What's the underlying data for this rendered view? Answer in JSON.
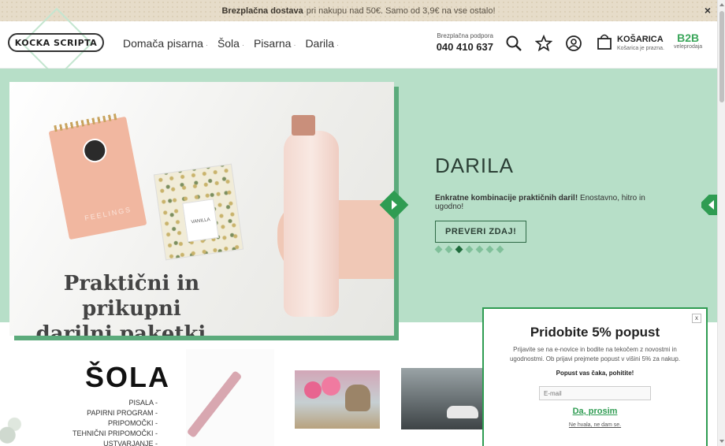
{
  "announcement": {
    "bold": "Brezplačna dostava",
    "text": "pri nakupu nad 50€. Samo od 3,9€ na vse ostalo!",
    "close": "×"
  },
  "header": {
    "logo": "KOCKA SCRIPTA",
    "nav": [
      {
        "label": "Domača pisarna"
      },
      {
        "label": "Šola"
      },
      {
        "label": "Pisarna"
      },
      {
        "label": "Darila"
      }
    ],
    "nav_arrow": "·",
    "support_label": "Brezplačna podpora",
    "support_phone": "040 410 637",
    "cart_title": "KOŠARICA",
    "cart_sub": "Košarica je prazna.",
    "b2b": "B2B",
    "b2b_sub": "veleprodaja"
  },
  "hero": {
    "image_headline_line1": "Praktični in prikupni",
    "image_headline_line2": "darilni paketki...",
    "notepad_word": "FEELINGS",
    "candle_label": "VANILLA",
    "title": "DARILA",
    "tagline_bold": "Enkratne kombinacije praktičnih daril!",
    "tagline_rest": "Enostavno, hitro in ugodno!",
    "button": "PREVERI ZDAJ!",
    "slide_count": 7,
    "active_slide": 3
  },
  "category": {
    "title": "ŠOLA",
    "items": [
      "PISALA -",
      "PAPIRNI PROGRAM -",
      "PRIPOMOČKI -",
      "TEHNIČNI PRIPOMOČKI -",
      "USTVARJANJE -"
    ]
  },
  "popup": {
    "title": "Pridobite 5% popust",
    "desc": "Prijavite se na e-novice in bodite na tekočem z novostmi in ugodnostmi. Ob prijavi prejmete popust v višini 5% za nakup.",
    "wait": "Popust vas čaka, pohitite!",
    "email_placeholder": "E-mail",
    "yes": "Da, prosim",
    "no": "Ne hvala, ne dam se.",
    "close": "x"
  },
  "colors": {
    "accent_green": "#2f9c52",
    "hero_bg": "#b7dfc8",
    "topbar_bg": "#e6dcc9"
  }
}
